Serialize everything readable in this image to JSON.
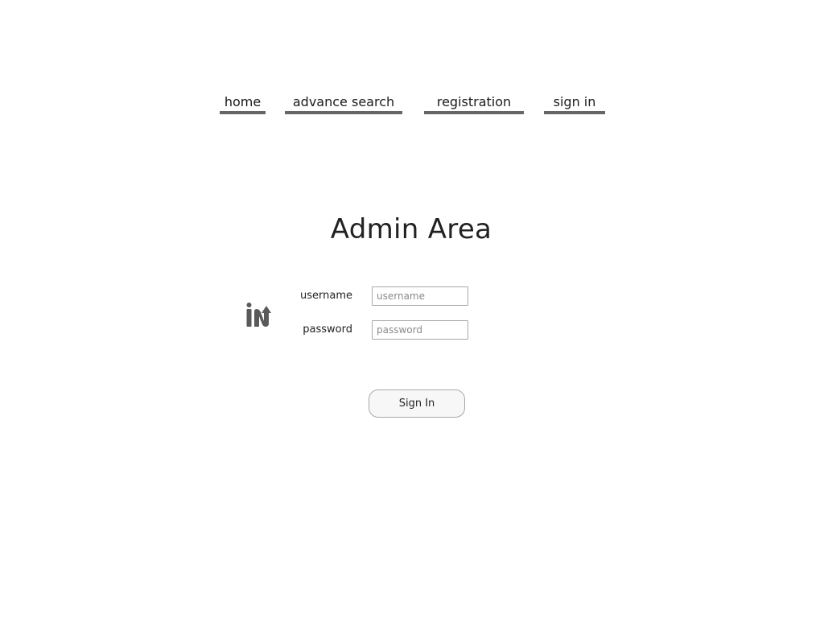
{
  "nav": {
    "items": [
      {
        "label": "home"
      },
      {
        "label": "advance search"
      },
      {
        "label": "registration"
      },
      {
        "label": "sign in"
      }
    ]
  },
  "page": {
    "title": "Admin Area"
  },
  "form": {
    "username_label": "username",
    "username_placeholder": "username",
    "username_value": "",
    "password_label": "password",
    "password_placeholder": "password",
    "password_value": "",
    "submit_label": "Sign In"
  },
  "logo": {
    "icon": "in-logo-icon",
    "color": "#5a5a5a"
  },
  "colors": {
    "nav_underline": "#666666",
    "text": "#222222",
    "input_border": "#a8a8a8",
    "button_bg": "#f7f7f7"
  }
}
